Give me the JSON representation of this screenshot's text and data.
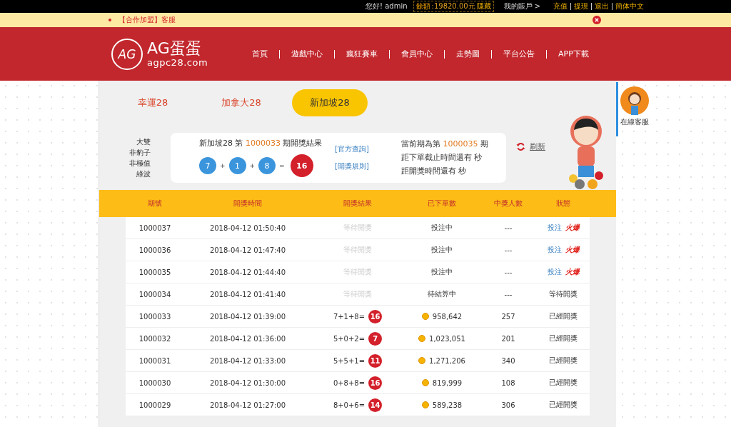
{
  "topbar": {
    "greeting": "您好! admin",
    "balance_label": "餘額",
    "balance": ":19820.00元",
    "hide": "隱藏",
    "account": "我的賬戶 >",
    "links": [
      "充值",
      "提現",
      "退出",
      "簡体中文"
    ]
  },
  "notice": {
    "text": "【合作加盟】客服"
  },
  "header": {
    "logo_mark": "AG",
    "logo_title": "AG蛋蛋",
    "logo_url": "agpc28.com",
    "nav": [
      "首頁",
      "遊戲中心",
      "瘋狂賽車",
      "會員中心",
      "走勢圖",
      "平台公告",
      "APP下載"
    ]
  },
  "tabs": [
    {
      "label": "幸運28",
      "selected": false
    },
    {
      "label": "加拿大28",
      "selected": false
    },
    {
      "label": "新加坡28",
      "selected": true
    }
  ],
  "tags": [
    "大雙",
    "非豹子",
    "非極值",
    "綠波"
  ],
  "last_result": {
    "prefix": "新加坡28 第",
    "issue": "1000033",
    "suffix": "期開獎結果",
    "balls": [
      "7",
      "1",
      "8"
    ],
    "plus": "+",
    "equals": "=",
    "sum": "16",
    "links": [
      "[官方查詢]",
      "[開獎規則]"
    ]
  },
  "current": {
    "prefix": "當前期為第",
    "issue": "1000035",
    "suffix": "期",
    "lines": [
      "距下單截止時間還有 秒",
      "距開獎時間還有 秒"
    ]
  },
  "refresh": "刷新",
  "table": {
    "columns": [
      "期號",
      "開獎時間",
      "開獎結果",
      "已下單數",
      "中獎人數",
      "狀態"
    ],
    "rows": [
      {
        "issue": "1000037",
        "time": "2018-04-12 01:50:40",
        "result": {
          "kind": "pending",
          "text": "等待開獎"
        },
        "bets": "投注中",
        "winners": "---",
        "status": {
          "kind": "bet",
          "text": "投注",
          "hot": "火爆"
        }
      },
      {
        "issue": "1000036",
        "time": "2018-04-12 01:47:40",
        "result": {
          "kind": "pending",
          "text": "等待開獎"
        },
        "bets": "投注中",
        "winners": "---",
        "status": {
          "kind": "bet",
          "text": "投注",
          "hot": "火爆"
        }
      },
      {
        "issue": "1000035",
        "time": "2018-04-12 01:44:40",
        "result": {
          "kind": "pending",
          "text": "等待開獎"
        },
        "bets": "投注中",
        "winners": "---",
        "status": {
          "kind": "bet",
          "text": "投注",
          "hot": "火爆"
        }
      },
      {
        "issue": "1000034",
        "time": "2018-04-12 01:41:40",
        "result": {
          "kind": "pending",
          "text": "等待開獎"
        },
        "bets": "待結算中",
        "winners": "---",
        "status": {
          "kind": "text",
          "text": "等待開獎"
        }
      },
      {
        "issue": "1000033",
        "time": "2018-04-12 01:39:00",
        "result": {
          "kind": "drawn",
          "expr": "7+1+8=",
          "sum": "16"
        },
        "bets": "958,642",
        "winners": "257",
        "status": {
          "kind": "text",
          "text": "已經開獎"
        }
      },
      {
        "issue": "1000032",
        "time": "2018-04-12 01:36:00",
        "result": {
          "kind": "drawn",
          "expr": "5+0+2=",
          "sum": "7"
        },
        "bets": "1,023,051",
        "winners": "201",
        "status": {
          "kind": "text",
          "text": "已經開獎"
        }
      },
      {
        "issue": "1000031",
        "time": "2018-04-12 01:33:00",
        "result": {
          "kind": "drawn",
          "expr": "5+5+1=",
          "sum": "11"
        },
        "bets": "1,271,206",
        "winners": "340",
        "status": {
          "kind": "text",
          "text": "已經開獎"
        }
      },
      {
        "issue": "1000030",
        "time": "2018-04-12 01:30:00",
        "result": {
          "kind": "drawn",
          "expr": "0+8+8=",
          "sum": "16"
        },
        "bets": "819,999",
        "winners": "108",
        "status": {
          "kind": "text",
          "text": "已經開獎"
        }
      },
      {
        "issue": "1000029",
        "time": "2018-04-12 01:27:00",
        "result": {
          "kind": "drawn",
          "expr": "8+0+6=",
          "sum": "14"
        },
        "bets": "589,238",
        "winners": "306",
        "status": {
          "kind": "text",
          "text": "已經開獎"
        }
      }
    ]
  },
  "service": {
    "label": "在線客服"
  }
}
